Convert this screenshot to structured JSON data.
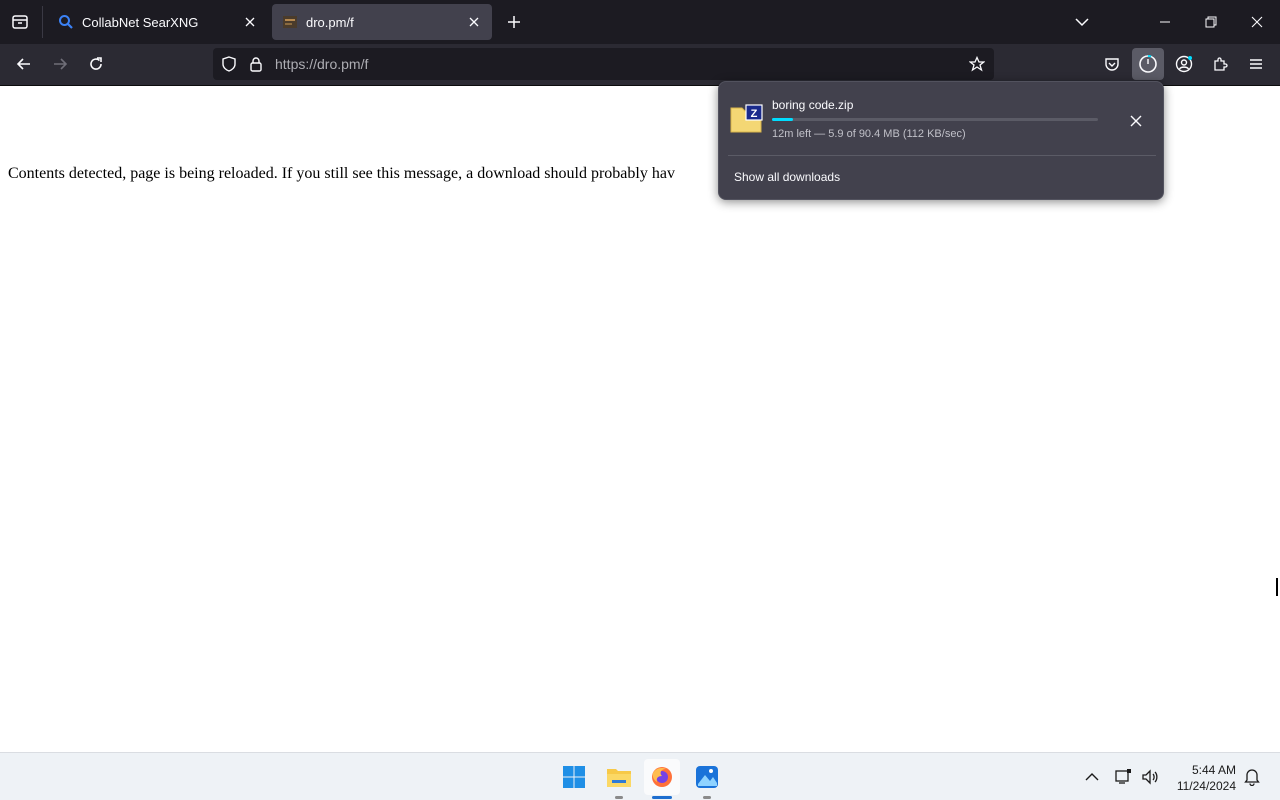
{
  "browser": {
    "tabs": [
      {
        "title": "CollabNet SearXNG",
        "active": false
      },
      {
        "title": "dro.pm/f",
        "active": true
      }
    ],
    "url": "https://dro.pm/f"
  },
  "page": {
    "message": "Contents detected, page is being reloaded. If you still see this message, a download should probably hav"
  },
  "downloads_panel": {
    "items": [
      {
        "name": "boring code.zip",
        "status": "12m left — 5.9 of 90.4 MB (112 KB/sec)",
        "progress": 0.065
      }
    ],
    "show_all_label": "Show all downloads"
  },
  "taskbar": {
    "time": "5:44 AM",
    "date": "11/24/2024"
  },
  "colors": {
    "progress_accent": "#00ddff",
    "toolbar_bg": "#2b2a33",
    "tabstrip_bg": "#1c1b22"
  }
}
